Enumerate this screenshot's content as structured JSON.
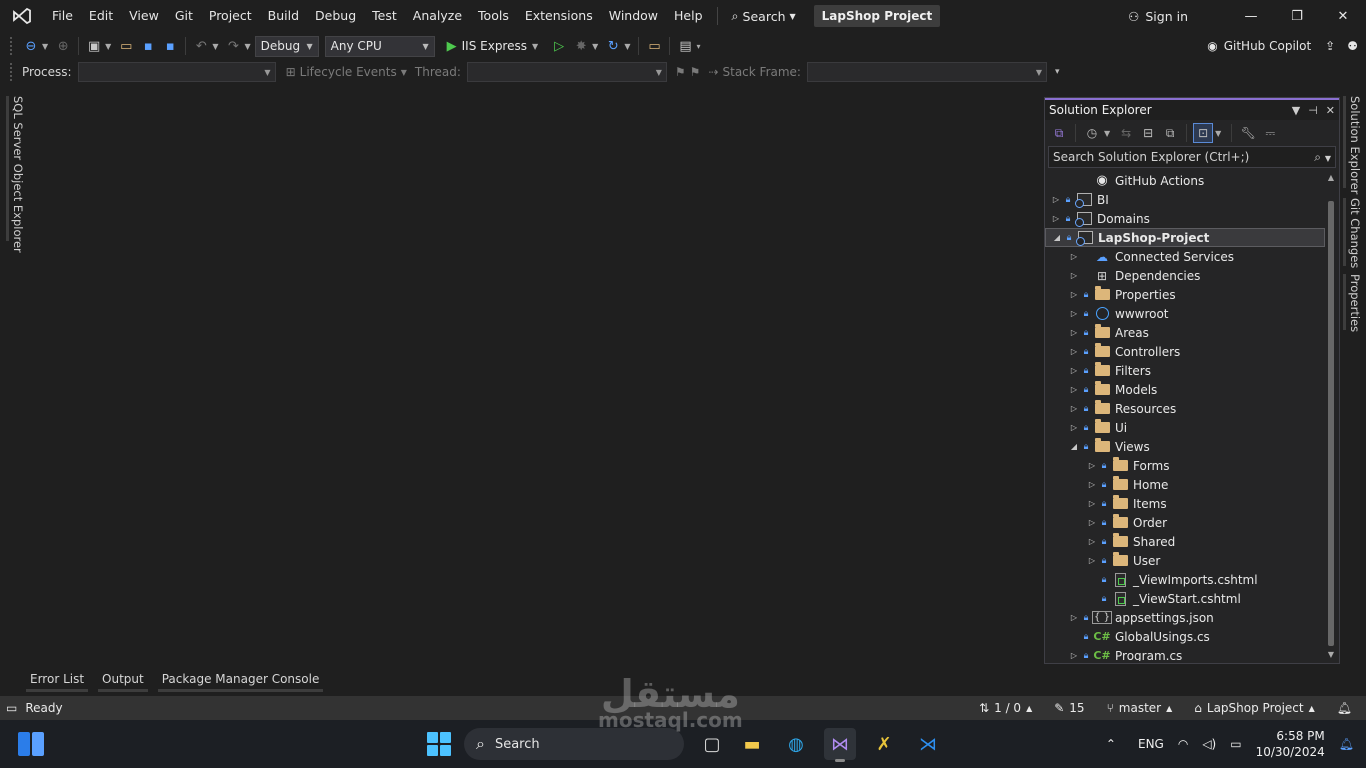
{
  "menu": {
    "items": [
      "File",
      "Edit",
      "View",
      "Git",
      "Project",
      "Build",
      "Debug",
      "Test",
      "Analyze",
      "Tools",
      "Extensions",
      "Window",
      "Help"
    ],
    "search_label": "Search",
    "project_name": "LapShop Project",
    "sign_in": "Sign in"
  },
  "toolbar": {
    "configuration": "Debug",
    "platform": "Any CPU",
    "run_target": "IIS Express",
    "copilot": "GitHub Copilot"
  },
  "debug_toolbar": {
    "process_label": "Process:",
    "lifecycle_label": "Lifecycle Events",
    "thread_label": "Thread:",
    "stack_frame_label": "Stack Frame:"
  },
  "left_tab": "SQL Server Object Explorer",
  "solution_explorer": {
    "title": "Solution Explorer",
    "search_placeholder": "Search Solution Explorer (Ctrl+;)",
    "tree": [
      {
        "label": "GitHub Actions",
        "level": 1,
        "expander": "none",
        "lock": false,
        "icon": "github-icon"
      },
      {
        "label": "BI",
        "level": 0,
        "expander": "collapsed",
        "lock": true,
        "icon": "project-icon"
      },
      {
        "label": "Domains",
        "level": 0,
        "expander": "collapsed",
        "lock": true,
        "icon": "project-icon"
      },
      {
        "label": "LapShop-Project",
        "level": 0,
        "expander": "expanded",
        "lock": true,
        "icon": "project-icon",
        "selected": true,
        "bold": true
      },
      {
        "label": "Connected Services",
        "level": 1,
        "expander": "collapsed",
        "lock": false,
        "icon": "connected-services-icon"
      },
      {
        "label": "Dependencies",
        "level": 1,
        "expander": "collapsed",
        "lock": false,
        "icon": "dependencies-icon"
      },
      {
        "label": "Properties",
        "level": 1,
        "expander": "collapsed",
        "lock": true,
        "icon": "properties-folder-icon"
      },
      {
        "label": "wwwroot",
        "level": 1,
        "expander": "collapsed",
        "lock": true,
        "icon": "globe-icon"
      },
      {
        "label": "Areas",
        "level": 1,
        "expander": "collapsed",
        "lock": true,
        "icon": "folder-icon"
      },
      {
        "label": "Controllers",
        "level": 1,
        "expander": "collapsed",
        "lock": true,
        "icon": "folder-icon"
      },
      {
        "label": "Filters",
        "level": 1,
        "expander": "collapsed",
        "lock": true,
        "icon": "folder-icon"
      },
      {
        "label": "Models",
        "level": 1,
        "expander": "collapsed",
        "lock": true,
        "icon": "folder-icon"
      },
      {
        "label": "Resources",
        "level": 1,
        "expander": "collapsed",
        "lock": true,
        "icon": "folder-icon"
      },
      {
        "label": "Ui",
        "level": 1,
        "expander": "collapsed",
        "lock": true,
        "icon": "folder-icon"
      },
      {
        "label": "Views",
        "level": 1,
        "expander": "expanded",
        "lock": true,
        "icon": "folder-icon"
      },
      {
        "label": "Forms",
        "level": 2,
        "expander": "collapsed",
        "lock": true,
        "icon": "folder-icon"
      },
      {
        "label": "Home",
        "level": 2,
        "expander": "collapsed",
        "lock": true,
        "icon": "folder-icon"
      },
      {
        "label": "Items",
        "level": 2,
        "expander": "collapsed",
        "lock": true,
        "icon": "folder-icon"
      },
      {
        "label": "Order",
        "level": 2,
        "expander": "collapsed",
        "lock": true,
        "icon": "folder-icon"
      },
      {
        "label": "Shared",
        "level": 2,
        "expander": "collapsed",
        "lock": true,
        "icon": "folder-icon"
      },
      {
        "label": "User",
        "level": 2,
        "expander": "collapsed",
        "lock": true,
        "icon": "folder-icon"
      },
      {
        "label": "_ViewImports.cshtml",
        "level": 2,
        "expander": "none",
        "lock": true,
        "icon": "cshtml-file-icon"
      },
      {
        "label": "_ViewStart.cshtml",
        "level": 2,
        "expander": "none",
        "lock": true,
        "icon": "cshtml-file-icon"
      },
      {
        "label": "appsettings.json",
        "level": 1,
        "expander": "collapsed",
        "lock": true,
        "icon": "json-file-icon"
      },
      {
        "label": "GlobalUsings.cs",
        "level": 1,
        "expander": "none",
        "lock": true,
        "icon": "csharp-file-icon"
      },
      {
        "label": "Program.cs",
        "level": 1,
        "expander": "collapsed",
        "lock": true,
        "icon": "csharp-file-icon"
      }
    ]
  },
  "right_tabs": [
    "Solution Explorer",
    "Git Changes",
    "Properties"
  ],
  "bottom_tabs": [
    "Error List",
    "Output",
    "Package Manager Console"
  ],
  "status": {
    "ready": "Ready",
    "sync": "1 / 0",
    "changes": "15",
    "branch": "master",
    "repo": "LapShop Project"
  },
  "taskbar": {
    "search": "Search",
    "language": "ENG",
    "time": "6:58 PM",
    "date": "10/30/2024"
  },
  "watermark": {
    "arabic": "مستقل",
    "latin": "mostaql.com"
  },
  "colors": {
    "background": "#1f1f1f",
    "panel": "#252526",
    "status_bar": "#333333",
    "accent": "#8a6fd1",
    "folder": "#dcb67a",
    "lock": "#5aa0ff",
    "run_green": "#4ec94e"
  }
}
